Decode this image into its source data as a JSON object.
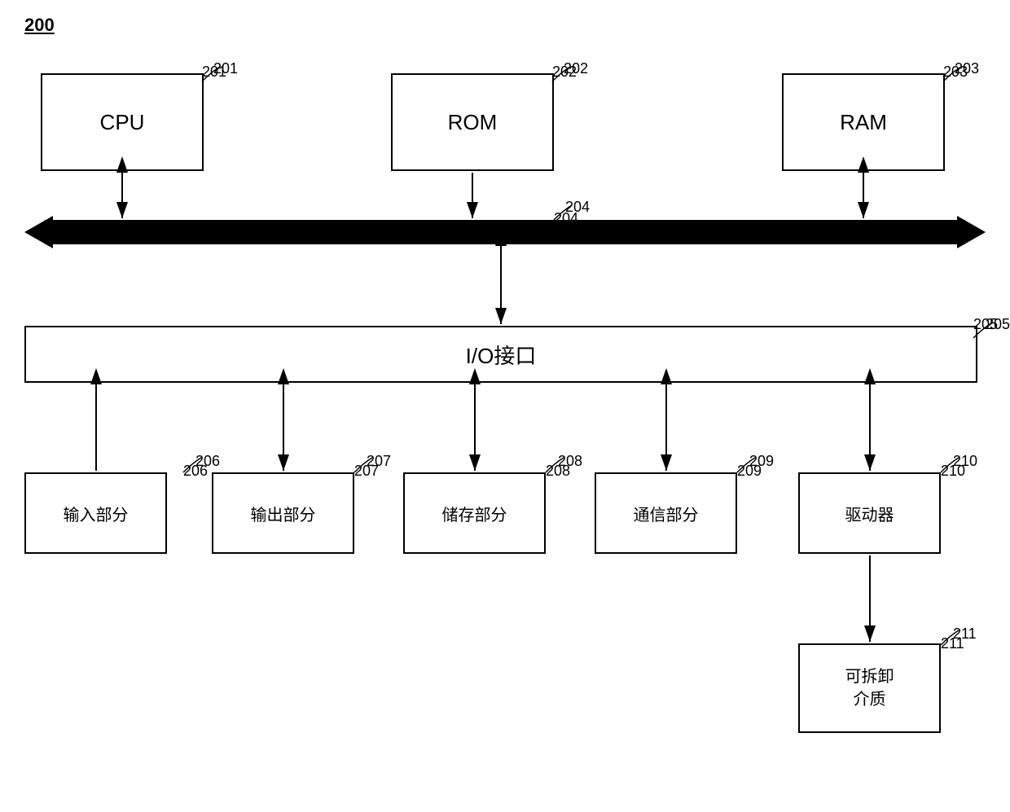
{
  "diagram": {
    "figure_label": "200",
    "boxes": {
      "cpu": {
        "label": "CPU",
        "ref": "201"
      },
      "rom": {
        "label": "ROM",
        "ref": "202"
      },
      "ram": {
        "label": "RAM",
        "ref": "203"
      },
      "bus": {
        "ref": "204"
      },
      "io": {
        "label": "I/O接口",
        "ref": "205"
      },
      "input": {
        "label": "输入部分",
        "ref": "206"
      },
      "output": {
        "label": "输出部分",
        "ref": "207"
      },
      "storage": {
        "label": "储存部分",
        "ref": "208"
      },
      "comm": {
        "label": "通信部分",
        "ref": "209"
      },
      "driver": {
        "label": "驱动器",
        "ref": "210"
      },
      "media": {
        "label": "可拆卸\n介质",
        "ref": "211"
      }
    }
  }
}
